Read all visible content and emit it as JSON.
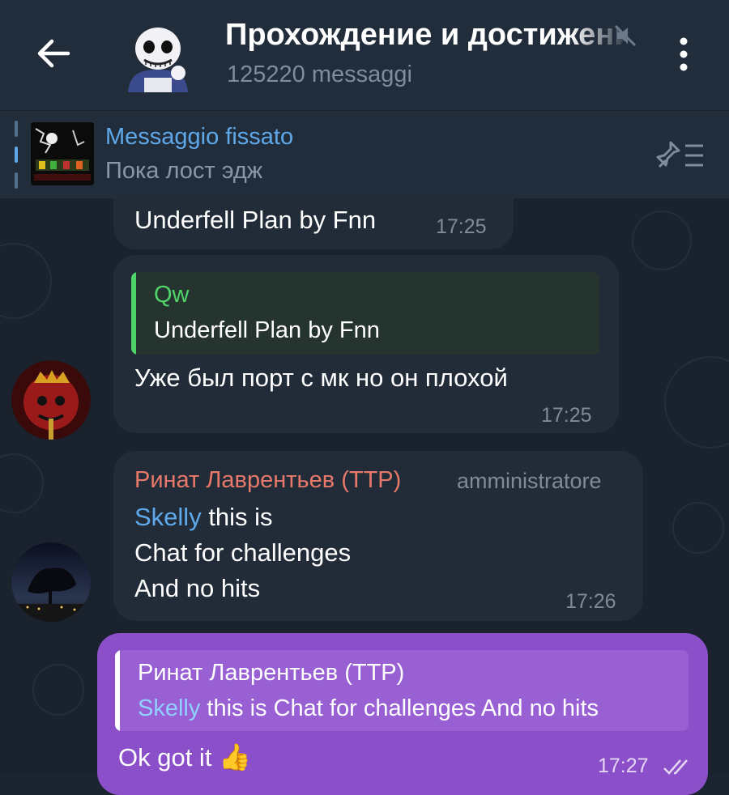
{
  "header": {
    "title": "Прохождение и достижения",
    "subtitle": "125220 messaggi"
  },
  "pinned": {
    "label": "Messaggio fissato",
    "text": "Пока лост эдж"
  },
  "messages": [
    {
      "text": "Underfell Plan by Fnn",
      "time": "17:25"
    },
    {
      "reply_author": "Qw",
      "reply_text": "Underfell Plan by Fnn",
      "text": "Уже был порт с мк но он плохой",
      "time": "17:25"
    },
    {
      "author": "Ринат Лаврентьев (TTP)",
      "role": "amministratore",
      "mention": "Skelly",
      "line1_rest": " this is",
      "line2": "Chat for challenges",
      "line3": "And no hits",
      "time": "17:26"
    },
    {
      "reply_author": "Ринат Лаврентьев (TTP)",
      "reply_mention": "Skelly",
      "reply_rest": " this is Chat for challenges And no hits",
      "text": "Ok got it",
      "emoji": "👍",
      "time": "17:27"
    }
  ],
  "colors": {
    "accent": "#5fa9ea",
    "outgoing": "#8a4fc9",
    "quote_green": "#4fd46a",
    "author_orange": "#e8796a"
  }
}
